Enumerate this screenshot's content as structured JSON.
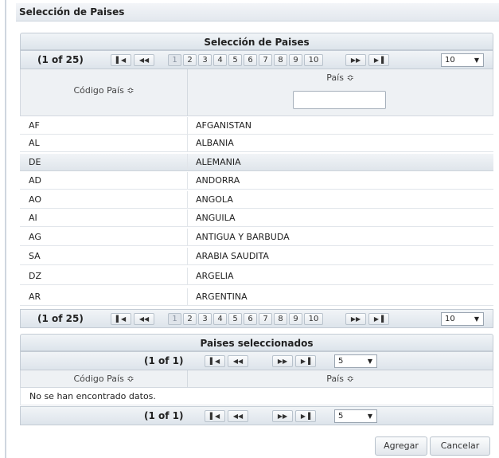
{
  "dialog": {
    "title": "Selección de Paises"
  },
  "main": {
    "header": "Selección de Paises",
    "pager": {
      "count": "(1 of 25)",
      "first": "⏮",
      "prev": "⏪",
      "next": "⏩",
      "last": "⏭",
      "pages": [
        "1",
        "2",
        "3",
        "4",
        "5",
        "6",
        "7",
        "8",
        "9",
        "10"
      ],
      "rows_per_page": "10"
    },
    "columns": {
      "code": "Código País ≎",
      "country": "País ≎"
    },
    "rows": [
      {
        "code": "AF",
        "country": "AFGANISTAN"
      },
      {
        "code": "AL",
        "country": "ALBANIA"
      },
      {
        "code": "DE",
        "country": "ALEMANIA"
      },
      {
        "code": "AD",
        "country": "ANDORRA"
      },
      {
        "code": "AO",
        "country": "ANGOLA"
      },
      {
        "code": "AI",
        "country": "ANGUILA"
      },
      {
        "code": "AG",
        "country": "ANTIGUA Y BARBUDA"
      },
      {
        "code": "SA",
        "country": "ARABIA SAUDITA"
      },
      {
        "code": "DZ",
        "country": "ARGELIA"
      },
      {
        "code": "AR",
        "country": "ARGENTINA"
      }
    ]
  },
  "selected": {
    "header": "Paises seleccionados",
    "pager": {
      "count": "(1 of 1)",
      "rows_per_page": "5"
    },
    "columns": {
      "code": "Código País ≎",
      "country": "País ≎"
    },
    "empty_message": "No se han encontrado datos."
  },
  "buttons": {
    "add": "Agregar",
    "cancel": "Cancelar"
  }
}
